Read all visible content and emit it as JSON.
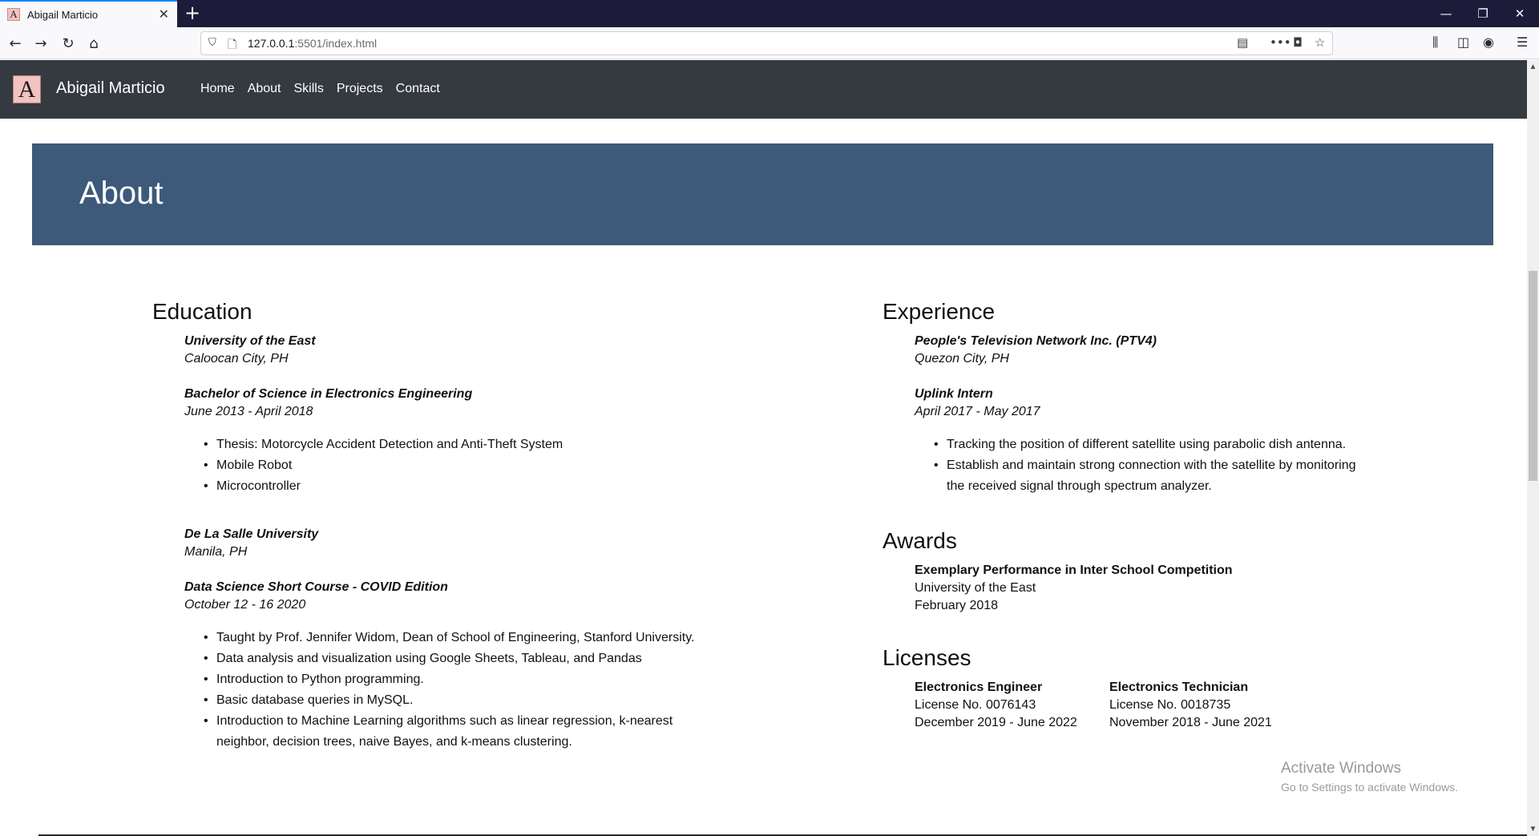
{
  "browser": {
    "tab_title": "Abigail Marticio",
    "tab_favicon_letter": "A",
    "url_host": "127.0.0.1",
    "url_rest": ":5501/index.html"
  },
  "site": {
    "logo_letter": "A",
    "brand": "Abigail Marticio",
    "nav": [
      "Home",
      "About",
      "Skills",
      "Projects",
      "Contact"
    ]
  },
  "banner": {
    "title": "About"
  },
  "education": {
    "heading": "Education",
    "entries": [
      {
        "school": "University of the East",
        "location": "Caloocan City, PH",
        "program": "Bachelor of Science in Electronics Engineering",
        "dates": "June 2013 - April 2018",
        "bullets": [
          "Thesis: Motorcycle Accident Detection and Anti-Theft System",
          "Mobile Robot",
          "Microcontroller"
        ]
      },
      {
        "school": "De La Salle University",
        "location": "Manila, PH",
        "program": "Data Science Short Course - COVID Edition",
        "dates": "October 12 - 16 2020",
        "bullets": [
          "Taught by Prof. Jennifer Widom, Dean of School of Engineering, Stanford University.",
          "Data analysis and visualization using Google Sheets, Tableau, and Pandas",
          "Introduction to Python programming.",
          "Basic database queries in MySQL.",
          "Introduction to Machine Learning algorithms such as linear regression, k-nearest",
          "neighbor, decision trees, naive Bayes, and k-means clustering."
        ]
      }
    ]
  },
  "experience": {
    "heading": "Experience",
    "company": "People's Television Network Inc. (PTV4)",
    "location": "Quezon City, PH",
    "role": "Uplink Intern",
    "dates": "April 2017 - May 2017",
    "bullets": [
      "Tracking the position of different satellite using parabolic dish antenna.",
      "Establish and maintain strong connection with the satellite by monitoring",
      "the received signal through spectrum analyzer."
    ]
  },
  "awards": {
    "heading": "Awards",
    "title": "Exemplary Performance in Inter School Competition",
    "org": "University of the East",
    "date": "February 2018"
  },
  "licenses": {
    "heading": "Licenses",
    "items": [
      {
        "title": "Electronics Engineer",
        "number": "License No. 0076143",
        "dates": "December 2019 - June 2022"
      },
      {
        "title": "Electronics Technician",
        "number": "License No. 0018735",
        "dates": "November 2018 - June 2021"
      }
    ]
  },
  "watermark": {
    "line1": "Activate Windows",
    "line2": "Go to Settings to activate Windows."
  },
  "colors": {
    "navbar": "#343a40",
    "banner": "#3d5a7a",
    "logo": "#f2c3c0"
  }
}
